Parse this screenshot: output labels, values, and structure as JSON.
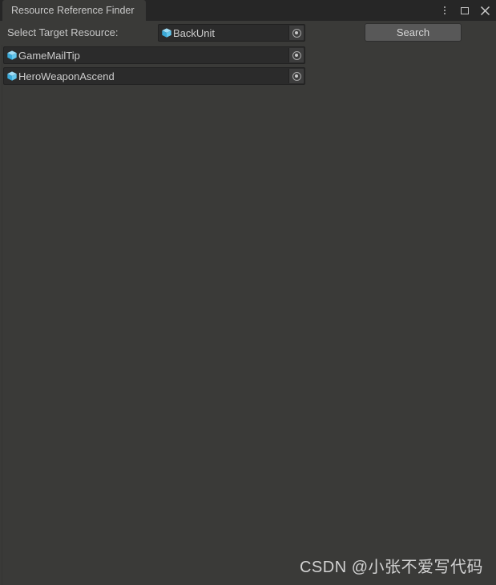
{
  "window": {
    "tab_label": "Resource Reference Finder",
    "controls": [
      {
        "name": "kebab-menu-icon",
        "label": "⋮"
      },
      {
        "name": "maximize-icon",
        "label": "□"
      },
      {
        "name": "close-icon",
        "label": "✕"
      }
    ],
    "close_glyph": "✕"
  },
  "search": {
    "label": "Select Target Resource:",
    "target_value": "BackUnit",
    "target_icon": "prefab-cube-icon",
    "picker_icon": "object-picker-icon",
    "button_label": "Search"
  },
  "results": {
    "items": [
      {
        "label": "GameMailTip",
        "icon": "prefab-cube-icon",
        "picker_icon": "object-picker-icon"
      },
      {
        "label": "HeroWeaponAscend",
        "icon": "prefab-cube-icon",
        "picker_icon": "object-picker-icon"
      }
    ]
  },
  "watermark": {
    "text": "CSDN @小张不爱写代码"
  },
  "colors": {
    "window_background": "#3a3a38",
    "titlebar_background": "#262626",
    "field_background": "#2b2b2b",
    "button_background": "#585858",
    "prefab_icon_blue": "#5ec8f2",
    "text": "#c8c8c8"
  }
}
